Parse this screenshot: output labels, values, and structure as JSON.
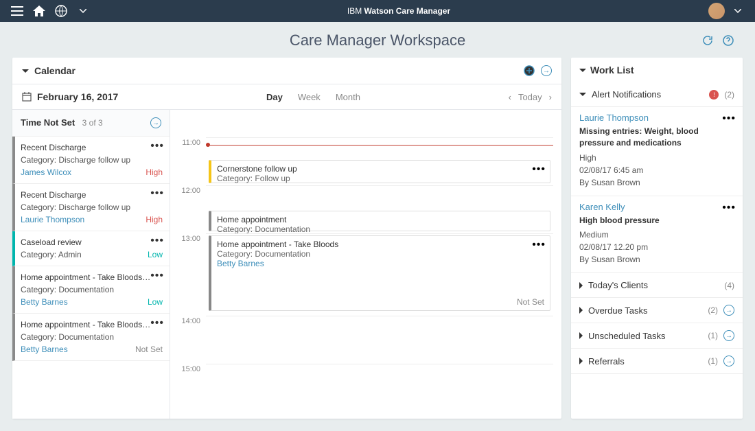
{
  "topbar": {
    "app_prefix": "IBM",
    "app_name": "Watson Care Manager"
  },
  "page": {
    "title": "Care Manager Workspace"
  },
  "calendar": {
    "title": "Calendar",
    "date": "February 16, 2017",
    "tabs": {
      "day": "Day",
      "week": "Week",
      "month": "Month"
    },
    "today": "Today",
    "time_not_set": {
      "label": "Time Not Set",
      "count": "3 of 3"
    },
    "side_items": [
      {
        "title": "Recent Discharge",
        "category": "Category: Discharge follow up",
        "person": "James Wilcox",
        "badge": "High",
        "badge_type": "high",
        "color": "grey"
      },
      {
        "title": "Recent Discharge",
        "category": "Category: Discharge follow up",
        "person": "Laurie Thompson",
        "badge": "High",
        "badge_type": "high",
        "color": "grey"
      },
      {
        "title": "Caseload review",
        "category": "Category: Admin",
        "person": "",
        "badge": "Low",
        "badge_type": "low",
        "color": "teal"
      },
      {
        "title": "Home appointment - Take Bloods…",
        "category": "Category: Documentation",
        "person": "Betty Barnes",
        "badge": "Low",
        "badge_type": "low",
        "color": "grey"
      },
      {
        "title": "Home appointment - Take Bloods…",
        "category": "Category: Documentation",
        "person": "Betty Barnes",
        "badge": "Not Set",
        "badge_type": "notset",
        "color": "grey"
      }
    ],
    "hours": [
      "11:00",
      "12:00",
      "13:00",
      "14:00",
      "15:00"
    ],
    "events": [
      {
        "title": "Cornerstone follow up",
        "category": "Category: Follow up",
        "color": "yellow"
      },
      {
        "title": "Home appointment",
        "category": "Category: Documentation",
        "color": "grey"
      },
      {
        "title": "Home appointment - Take Bloods",
        "category": "Category: Documentation",
        "person": "Betty Barnes",
        "badge": "Not Set",
        "color": "grey"
      }
    ]
  },
  "worklist": {
    "title": "Work List",
    "alerts_title": "Alert Notifications",
    "alerts_count": "(2)",
    "alerts": [
      {
        "name": "Laurie Thompson",
        "msg": "Missing entries: Weight, blood pressure and medications",
        "priority": "High",
        "date": "02/08/17  6:45 am",
        "by": "By Susan Brown"
      },
      {
        "name": "Karen Kelly",
        "msg": "High blood pressure",
        "priority": "Medium",
        "date": "02/08/17  12.20 pm",
        "by": "By Susan Brown"
      }
    ],
    "sections": [
      {
        "title": "Today's Clients",
        "count": "(4)",
        "arrow": false
      },
      {
        "title": "Overdue Tasks",
        "count": "(2)",
        "arrow": true
      },
      {
        "title": "Unscheduled Tasks",
        "count": "(1)",
        "arrow": true
      },
      {
        "title": "Referrals",
        "count": "(1)",
        "arrow": true
      }
    ]
  }
}
